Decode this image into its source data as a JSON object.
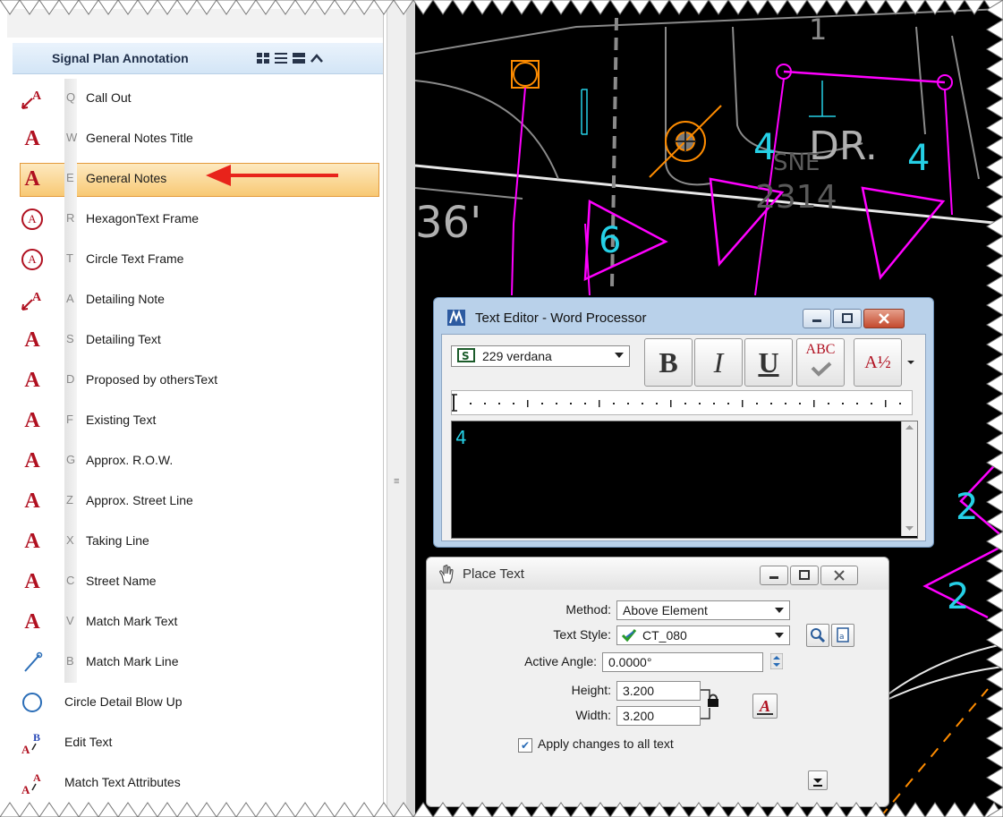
{
  "panel": {
    "title": "Signal Plan Annotation",
    "tools": [
      {
        "key": "Q",
        "label": "Call Out",
        "icon": "callout-icon"
      },
      {
        "key": "W",
        "label": "General Notes Title",
        "icon": "text-a-icon"
      },
      {
        "key": "E",
        "label": "General Notes",
        "icon": "text-a-icon",
        "selected": true
      },
      {
        "key": "R",
        "label": "HexagonText Frame",
        "icon": "circle-a-icon"
      },
      {
        "key": "T",
        "label": "Circle Text Frame",
        "icon": "circle-a-icon"
      },
      {
        "key": "A",
        "label": "Detailing Note",
        "icon": "callout-icon"
      },
      {
        "key": "S",
        "label": "Detailing Text",
        "icon": "text-a-icon"
      },
      {
        "key": "D",
        "label": "Proposed by othersText",
        "icon": "text-a-icon"
      },
      {
        "key": "F",
        "label": "Existing Text",
        "icon": "text-a-icon"
      },
      {
        "key": "G",
        "label": "Approx. R.O.W.",
        "icon": "text-a-icon"
      },
      {
        "key": "Z",
        "label": "Approx. Street Line",
        "icon": "text-a-icon"
      },
      {
        "key": "X",
        "label": "Taking Line",
        "icon": "text-a-icon"
      },
      {
        "key": "C",
        "label": "Street Name",
        "icon": "text-a-icon"
      },
      {
        "key": "V",
        "label": "Match Mark Text",
        "icon": "text-a-icon"
      },
      {
        "key": "B",
        "label": "Match Mark Line",
        "icon": "line-icon"
      },
      {
        "key": "",
        "label": "Circle Detail Blow Up",
        "icon": "circle-icon"
      },
      {
        "key": "",
        "label": "Edit Text",
        "icon": "edit-text-icon"
      },
      {
        "key": "",
        "label": "Match Text Attributes",
        "icon": "match-text-icon"
      }
    ]
  },
  "canvas": {
    "labels": [
      "DR.",
      "4",
      "4",
      "6",
      "36'",
      "2",
      "2",
      "1",
      "2314",
      "SNE"
    ]
  },
  "text_editor": {
    "title": "Text Editor - Word Processor",
    "font": "229 verdana",
    "bold_label": "B",
    "italic_label": "I",
    "underline_label": "U",
    "spell_label": "ABC",
    "fraction_label": "A½",
    "content": "4"
  },
  "place_text": {
    "title": "Place Text",
    "method_label": "Method:",
    "method_value": "Above Element",
    "text_style_label": "Text Style:",
    "text_style_value": "CT_080",
    "active_angle_label": "Active Angle:",
    "active_angle_value": "0.0000°",
    "height_label": "Height:",
    "height_value": "3.200",
    "width_label": "Width:",
    "width_value": "3.200",
    "apply_label": "Apply changes to all text",
    "apply_checked": true
  },
  "colors": {
    "selected_row": "#f8c974",
    "arrow": "#e8231b",
    "magenta": "#ff00ff",
    "cyan": "#25d0e6",
    "orange": "#ff8c00"
  }
}
